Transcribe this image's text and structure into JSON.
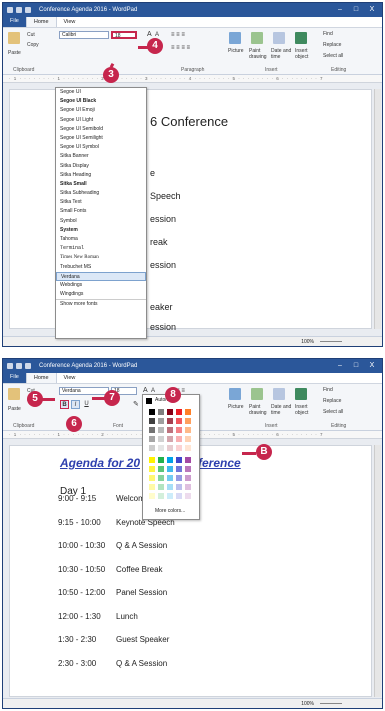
{
  "window_title": "Conference Agenda 2016 - WordPad",
  "window_controls": [
    "–",
    "□",
    "X"
  ],
  "tabs": {
    "file": "File",
    "home": "Home",
    "view": "View"
  },
  "clipboard": {
    "paste": "Paste",
    "cut": "Cut",
    "copy": "Copy",
    "label": "Clipboard"
  },
  "font_group_label": "Font",
  "paragraph_label": "Paragraph",
  "insert": {
    "picture": "Picture",
    "paint": "Paint drawing",
    "datetime": "Date and time",
    "object": "Insert object",
    "label": "Insert"
  },
  "editing": {
    "find": "Find",
    "replace": "Replace",
    "select_all": "Select all",
    "label": "Editing"
  },
  "top": {
    "font_value": "Calibri",
    "size_value": "18",
    "font_list": [
      "Segoe UI",
      "Segoe UI Black",
      "Segoe UI Emoji",
      "Segoe UI Light",
      "Segoe UI Semibold",
      "Segoe UI Semilight",
      "Segoe UI Symbol",
      "Sitka Banner",
      "Sitka Display",
      "Sitka Heading",
      "Sitka Small",
      "Sitka Subheading",
      "Sitka Text",
      "Small Fonts",
      "Symbol",
      "System",
      "Tahoma",
      "Terminal",
      "Times New Roman",
      "Trebuchet MS",
      "Verdana",
      "Webdings",
      "Wingdings"
    ],
    "selected_font": "Verdana",
    "show_more": "Show more fonts",
    "doc_title_fragment": "6 Conference",
    "doc_fragments": [
      "e",
      "Speech",
      "ession",
      "reak",
      "ession",
      "eaker",
      "ession"
    ],
    "zoom": "100%",
    "badges": {
      "b3": "3",
      "b4": "4"
    }
  },
  "bottom": {
    "font_value": "Verdana",
    "size_value": "18",
    "format_buttons": {
      "bold": "B",
      "italic": "I",
      "underline": "U"
    },
    "color_automatic": "Automatic",
    "color_more": "More colors...",
    "doc_title_left": "Agenda for 20",
    "doc_title_right": "ference",
    "day": "Day 1",
    "schedule": [
      {
        "time": "9:00 - 9:15",
        "event": "Welcome"
      },
      {
        "time": "9:15 - 10:00",
        "event": "Keynote Speech"
      },
      {
        "time": "10:00 - 10:30",
        "event": "Q & A Session"
      },
      {
        "time": "10:30 - 10:50",
        "event": "Coffee Break"
      },
      {
        "time": "10:50 - 12:00",
        "event": "Panel Session"
      },
      {
        "time": "12:00 - 1:30",
        "event": "Lunch"
      },
      {
        "time": "1:30 - 2:30",
        "event": "Guest Speaker"
      },
      {
        "time": "2:30 - 3:00",
        "event": "Q & A Session"
      }
    ],
    "zoom": "100%",
    "badges": {
      "b5": "5",
      "b6": "6",
      "b7": "7",
      "b8": "8",
      "bB": "B"
    }
  },
  "ruler_text": "· 1 · · · · · · · · 1 · · · · · · · · 2 · · · · · · · · 3 · · · · · · · · 4 · · · · · · · · 5 · · · · · · · · 6 · · · · · · · · 7",
  "palette_colors": [
    "#000000",
    "#7f7f7f",
    "#880015",
    "#ed1c24",
    "#ff7f27",
    "#fff200",
    "#22b14c",
    "#00a2e8",
    "#3f48cc",
    "#a349a4"
  ],
  "badge_color": "#c6264d",
  "accent_color": "#2b579a"
}
